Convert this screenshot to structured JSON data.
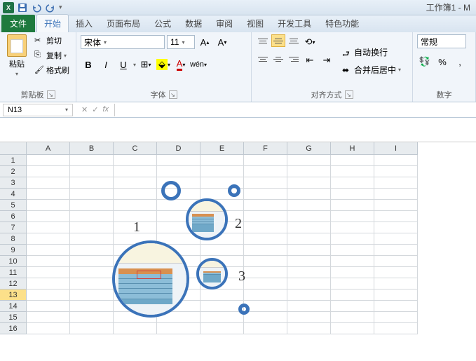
{
  "titlebar": {
    "title": "工作簿1 - M"
  },
  "tabs": {
    "file": "文件",
    "items": [
      "开始",
      "插入",
      "页面布局",
      "公式",
      "数据",
      "审阅",
      "视图",
      "开发工具",
      "特色功能"
    ],
    "active": 0
  },
  "ribbon": {
    "clipboard": {
      "paste": "粘贴",
      "cut": "剪切",
      "copy": "复制",
      "format_painter": "格式刷",
      "label": "剪贴板"
    },
    "font": {
      "family": "宋体",
      "size": "11",
      "label": "字体",
      "bold": "B",
      "italic": "I",
      "underline": "U"
    },
    "alignment": {
      "wrap": "自动换行",
      "merge": "合并后居中",
      "label": "对齐方式"
    },
    "number": {
      "format": "常规",
      "label": "数字"
    }
  },
  "formula_bar": {
    "cell_ref": "N13",
    "fx": "fx"
  },
  "grid": {
    "columns": [
      "A",
      "B",
      "C",
      "D",
      "E",
      "F",
      "G",
      "H",
      "I"
    ],
    "rows": [
      1,
      2,
      3,
      4,
      5,
      6,
      7,
      8,
      9,
      10,
      11,
      12,
      13,
      14,
      15,
      16
    ],
    "selected_row": 13
  },
  "bubbles": {
    "label1": "1",
    "label2": "2",
    "label3": "3"
  }
}
